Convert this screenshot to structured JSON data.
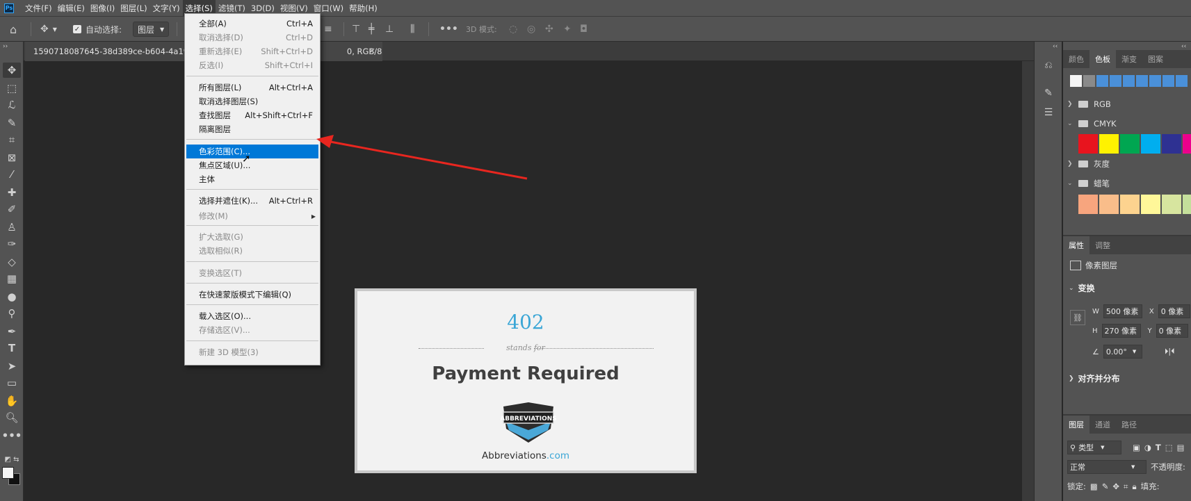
{
  "menubar": {
    "logo": "Ps",
    "items": [
      "文件(F)",
      "编辑(E)",
      "图像(I)",
      "图层(L)",
      "文字(Y)",
      "选择(S)",
      "滤镜(T)",
      "3D(D)",
      "视图(V)",
      "窗口(W)",
      "帮助(H)"
    ]
  },
  "options": {
    "auto_select_label": "自动选择:",
    "auto_select_target": "图层",
    "mode_3d_label": "3D 模式:"
  },
  "tab": {
    "title": "1590718087645-38d389ce-b604-4a19-98",
    "title_tail": "0, RGB/8) *",
    "close": "×"
  },
  "select_menu": {
    "items": [
      {
        "label": "全部(A)",
        "shortcut": "Ctrl+A",
        "disabled": false
      },
      {
        "label": "取消选择(D)",
        "shortcut": "Ctrl+D",
        "disabled": true
      },
      {
        "label": "重新选择(E)",
        "shortcut": "Shift+Ctrl+D",
        "disabled": true
      },
      {
        "label": "反选(I)",
        "shortcut": "Shift+Ctrl+I",
        "disabled": true
      },
      {
        "label": "所有图层(L)",
        "shortcut": "Alt+Ctrl+A",
        "disabled": false
      },
      {
        "label": "取消选择图层(S)",
        "shortcut": "",
        "disabled": false
      },
      {
        "label": "查找图层",
        "shortcut": "Alt+Shift+Ctrl+F",
        "disabled": false
      },
      {
        "label": "隔离图层",
        "shortcut": "",
        "disabled": false
      },
      {
        "label": "色彩范围(C)...",
        "shortcut": "",
        "disabled": false,
        "highlighted": true
      },
      {
        "label": "焦点区域(U)...",
        "shortcut": "",
        "disabled": false
      },
      {
        "label": "主体",
        "shortcut": "",
        "disabled": false
      },
      {
        "label": "选择并遮住(K)...",
        "shortcut": "Alt+Ctrl+R",
        "disabled": false
      },
      {
        "label": "修改(M)",
        "shortcut": "",
        "disabled": true,
        "submenu": true
      },
      {
        "label": "扩大选取(G)",
        "shortcut": "",
        "disabled": true
      },
      {
        "label": "选取相似(R)",
        "shortcut": "",
        "disabled": true
      },
      {
        "label": "变换选区(T)",
        "shortcut": "",
        "disabled": true
      },
      {
        "label": "在快速蒙版模式下编辑(Q)",
        "shortcut": "",
        "disabled": false
      },
      {
        "label": "载入选区(O)...",
        "shortcut": "",
        "disabled": false
      },
      {
        "label": "存储选区(V)...",
        "shortcut": "",
        "disabled": true
      },
      {
        "label": "新建 3D 模型(3)",
        "shortcut": "",
        "disabled": true
      }
    ]
  },
  "document": {
    "code": "402",
    "stands_for": "stands for",
    "title": "Payment Required",
    "logo_text": "ABBREVIATIONS",
    "site_name": "Abbreviations",
    "site_tld": ".com"
  },
  "swatches_panel": {
    "tabs": [
      "颜色",
      "色板",
      "渐变",
      "图案"
    ],
    "active_tab": "色板",
    "groups": [
      "RGB",
      "CMYK",
      "灰度",
      "蜡笔"
    ],
    "recent_colors": [
      "#f4f4f4",
      "#8a8a8a",
      "#4a90d9",
      "#4a90d9",
      "#4a90d9",
      "#4a90d9",
      "#4a90d9",
      "#4a90d9",
      "#4a90d9"
    ],
    "cmyk_colors": [
      "#e8141e",
      "#fff200",
      "#00a651",
      "#00aeef",
      "#2e3192",
      "#ec008c"
    ],
    "pastel_colors": [
      "#f7a57e",
      "#f9bd8a",
      "#fdd38f",
      "#fff799",
      "#d7e59f",
      "#c4df9b"
    ]
  },
  "properties_panel": {
    "tabs": [
      "属性",
      "调整"
    ],
    "active_tab": "属性",
    "layer_type": "像素图层",
    "transform_heading": "变换",
    "w_label": "W",
    "w_value": "500 像素",
    "h_label": "H",
    "h_value": "270 像素",
    "x_label": "X",
    "x_value": "0 像素",
    "y_label": "Y",
    "y_value": "0 像素",
    "angle_value": "0.00°",
    "align_heading": "对齐并分布"
  },
  "layers_panel": {
    "tabs": [
      "图层",
      "通道",
      "路径"
    ],
    "active_tab": "图层",
    "filter_kind": "类型",
    "blend_mode": "正常",
    "opacity_label": "不透明度:",
    "lock_label": "锁定:",
    "fill_label": "填充:"
  }
}
